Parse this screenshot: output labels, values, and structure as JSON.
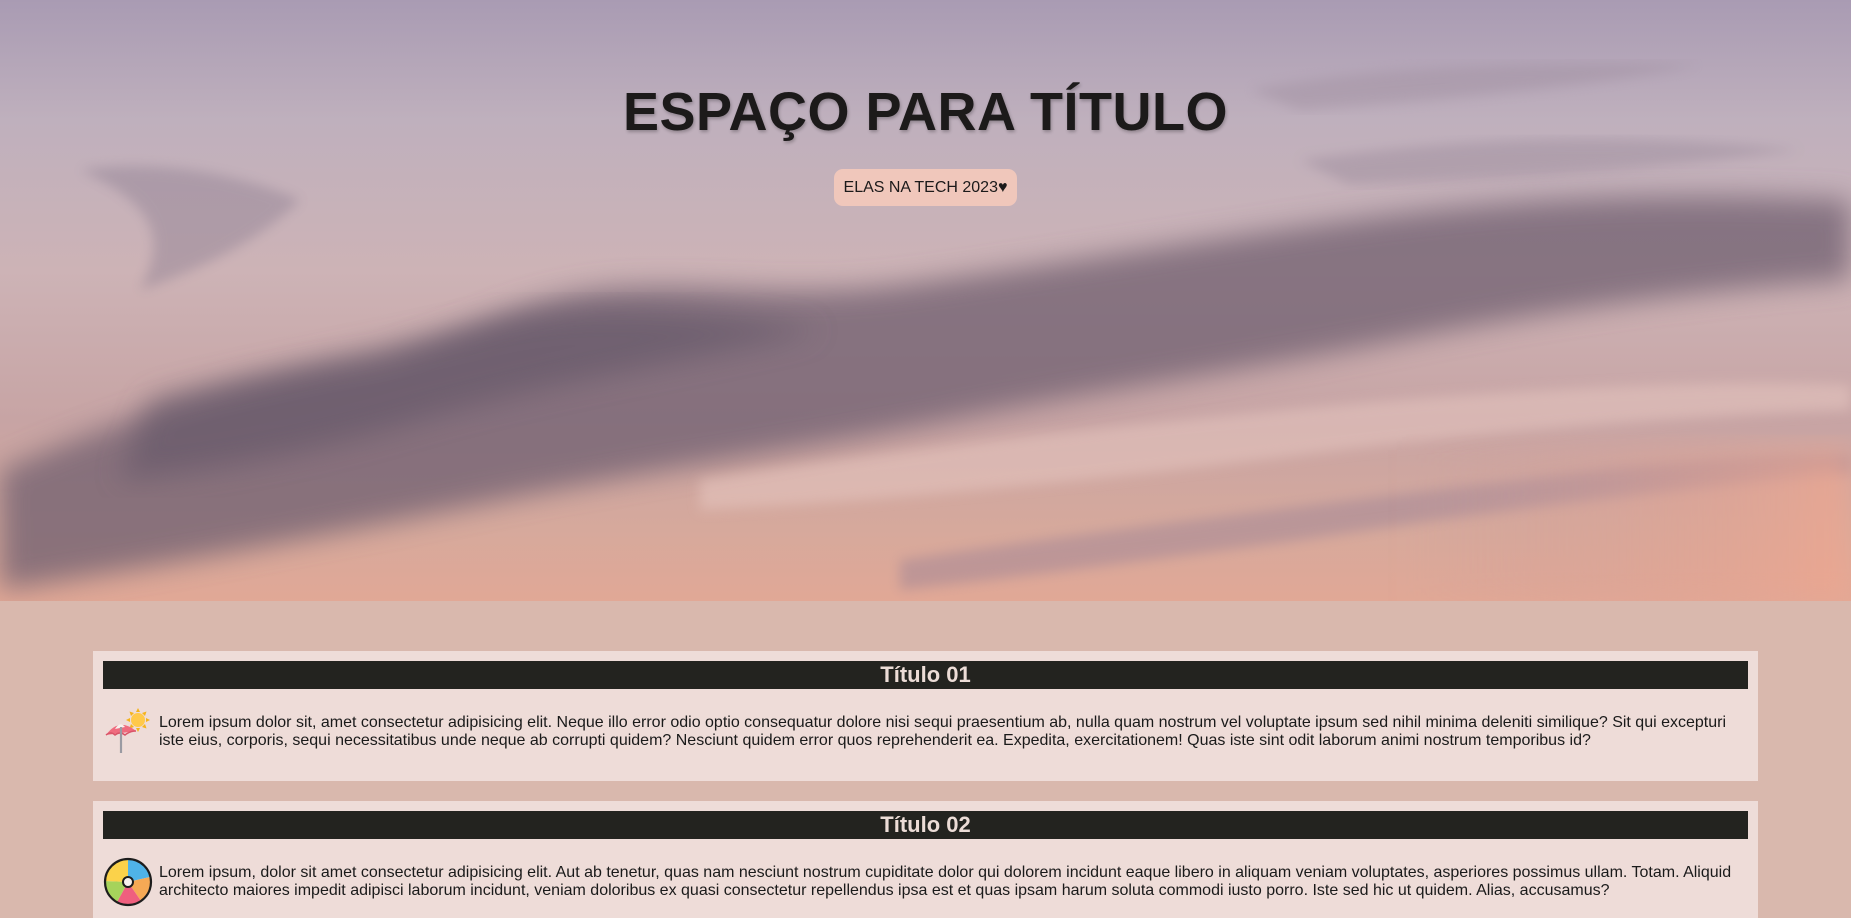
{
  "hero": {
    "title": "ESPAÇO PARA TÍTULO",
    "badge": "ELAS NA TECH 2023♥"
  },
  "cards": [
    {
      "title": "Título 01",
      "icon": "beach-umbrella-icon",
      "text": "Lorem ipsum dolor sit, amet consectetur adipisicing elit. Neque illo error odio optio consequatur dolore nisi sequi praesentium ab, nulla quam nostrum vel voluptate ipsum sed nihil minima deleniti similique? Sit qui excepturi iste eius, corporis, sequi necessitatibus unde neque ab corrupti quidem? Nesciunt quidem error quos reprehenderit ea. Expedita, exercitationem! Quas iste sint odit laborum animi nostrum temporibus id?"
    },
    {
      "title": "Título 02",
      "icon": "beach-ball-icon",
      "text": "Lorem ipsum, dolor sit amet consectetur adipisicing elit. Aut ab tenetur, quas nam nesciunt nostrum cupiditate dolor qui dolorem incidunt eaque libero in aliquam veniam voluptates, asperiores possimus ullam. Totam. Aliquid architecto maiores impedit adipisci laborum incidunt, veniam doloribus ex quasi consectetur repellendus ipsa est et quas ipsam harum soluta commodi iusto porro. Iste sed hic ut quidem. Alias, accusamus?"
    }
  ],
  "colors": {
    "page_background": "#d9b8ad",
    "card_background": "#eedcd8",
    "card_header": "#23231f",
    "badge_background": "#f0c7bb"
  }
}
